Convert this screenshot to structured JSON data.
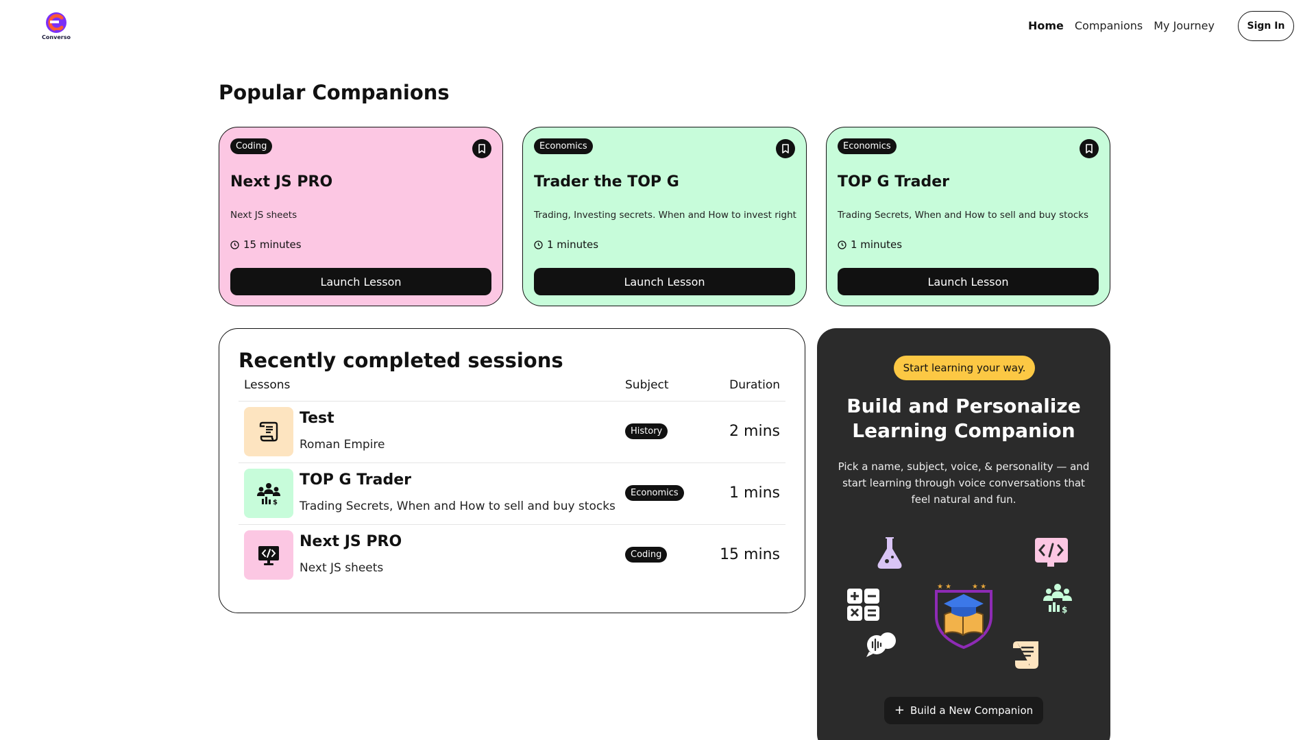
{
  "brand": {
    "name": "Converso"
  },
  "nav": {
    "links": [
      "Home",
      "Companions",
      "My Journey"
    ],
    "sign_in": "Sign In"
  },
  "popular": {
    "title": "Popular Companions",
    "cards": [
      {
        "subject": "Coding",
        "title": "Next JS PRO",
        "description": "Next JS sheets",
        "duration": "15 minutes",
        "cta": "Launch Lesson",
        "color": "#fcc7e3"
      },
      {
        "subject": "Economics",
        "title": "Trader the TOP G",
        "description": "Trading, Investing secrets. When and How to invest right",
        "duration": "1 minutes",
        "cta": "Launch Lesson",
        "color": "#c7fcda"
      },
      {
        "subject": "Economics",
        "title": "TOP G Trader",
        "description": "Trading Secrets, When and How to sell and buy stocks",
        "duration": "1 minutes",
        "cta": "Launch Lesson",
        "color": "#c7fcda"
      }
    ]
  },
  "sessions": {
    "title": "Recently completed sessions",
    "headers": {
      "lessons": "Lessons",
      "subject": "Subject",
      "duration": "Duration"
    },
    "rows": [
      {
        "name": "Test",
        "topic": "Roman Empire",
        "subject": "History",
        "duration": "2 mins",
        "icon": "scroll-icon",
        "color": "#fde4c0"
      },
      {
        "name": "TOP G Trader",
        "topic": "Trading Secrets, When and How to sell and buy stocks",
        "subject": "Economics",
        "duration": "1 mins",
        "icon": "economics-icon",
        "color": "#c7fcda"
      },
      {
        "name": "Next JS PRO",
        "topic": "Next JS sheets",
        "subject": "Coding",
        "duration": "15 mins",
        "icon": "coding-icon",
        "color": "#fcc7e3"
      }
    ]
  },
  "cta": {
    "pill": "Start learning your way.",
    "title": "Build and Personalize Learning Companion",
    "description": "Pick a name, subject, voice, & personality — and start learning through voice conversations that feel natural and fun.",
    "button": "Build a New Companion"
  },
  "colors": {
    "accent_yellow": "#fcc844",
    "dark_panel": "#2b2b2b",
    "pink": "#fcc7e3",
    "mint": "#c7fcda",
    "peach": "#fde4c0",
    "logo_purple": "#7b2ff7",
    "logo_orange": "#fe5933"
  }
}
